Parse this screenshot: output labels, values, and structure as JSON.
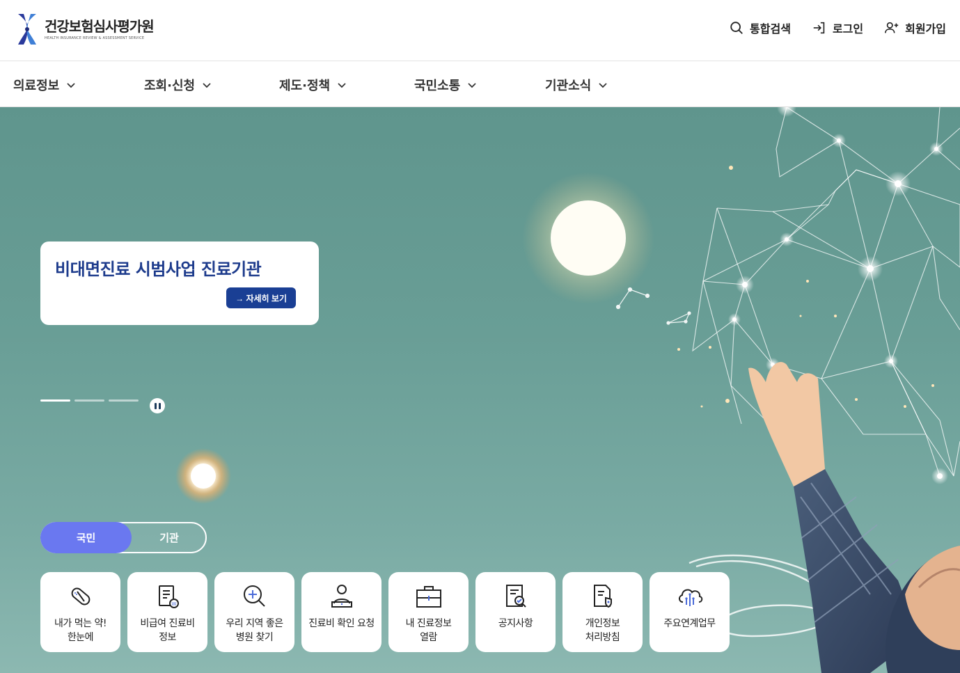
{
  "header": {
    "logo_title": "건강보험심사평가원",
    "logo_subtitle": "HEALTH INSURANCE REVIEW & ASSESSMENT SERVICE",
    "utilities": [
      {
        "label": "통합검색",
        "icon": "search-icon"
      },
      {
        "label": "로그인",
        "icon": "login-icon"
      },
      {
        "label": "회원가입",
        "icon": "add-user-icon"
      }
    ]
  },
  "nav": {
    "items": [
      {
        "label": "의료정보"
      },
      {
        "label": "조회·신청"
      },
      {
        "label": "제도·정책"
      },
      {
        "label": "국민소통"
      },
      {
        "label": "기관소식"
      }
    ]
  },
  "banner": {
    "title": "비대면진료 시범사업 진료기관",
    "button_label": "→ 자세히 보기",
    "slide_count": 3,
    "active_slide": 1
  },
  "audience_toggle": {
    "options": [
      "국민",
      "기관"
    ],
    "selected": "국민"
  },
  "quick_links": [
    {
      "label": "내가 먹는 약!\n한눈에",
      "icon": "pill-icon"
    },
    {
      "label": "비급여 진료비\n정보",
      "icon": "clipboard-won-icon"
    },
    {
      "label": "우리 지역 좋은\n병원 찾기",
      "icon": "magnifier-plus-icon"
    },
    {
      "label": "진료비 확인 요청",
      "icon": "person-laptop-icon"
    },
    {
      "label": "내 진료정보\n열람",
      "icon": "medical-case-icon"
    },
    {
      "label": "공지사항",
      "icon": "document-search-icon"
    },
    {
      "label": "개인정보\n처리방침",
      "icon": "document-shield-icon"
    },
    {
      "label": "주요연계업무",
      "icon": "cloud-network-icon"
    }
  ],
  "colors": {
    "brand_navy": "#1d3b8c",
    "toggle_accent": "#6a78f0",
    "hero_teal": "#699e96"
  }
}
